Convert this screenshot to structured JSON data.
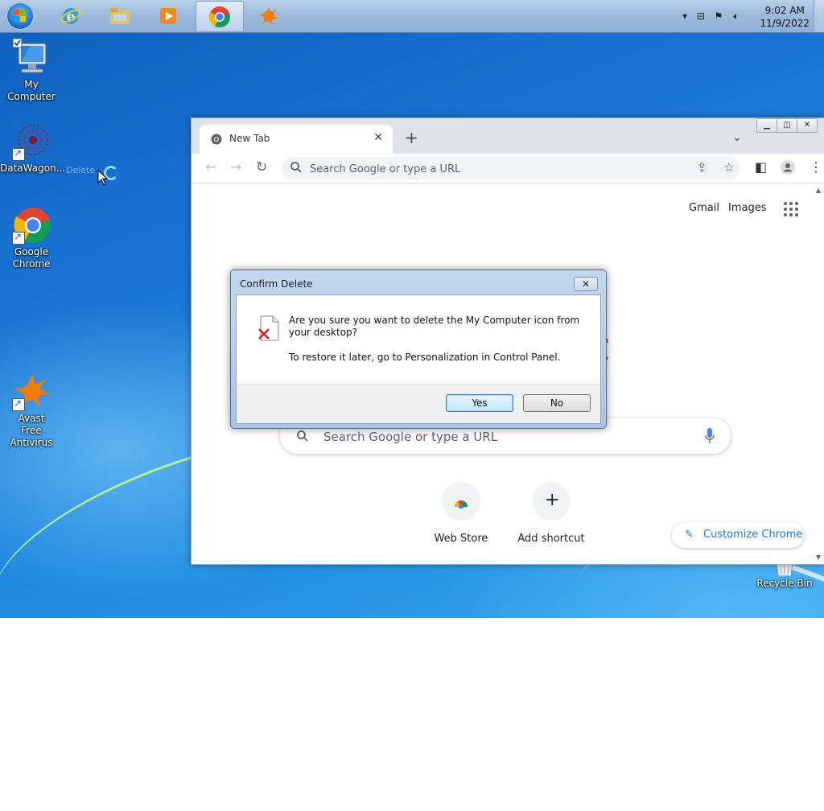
{
  "taskbar": {
    "clock_time": "9:02 AM",
    "clock_date": "11/9/2022",
    "pinned": [
      {
        "name": "internet-explorer-icon"
      },
      {
        "name": "file-explorer-icon"
      },
      {
        "name": "media-player-icon"
      },
      {
        "name": "chrome-icon",
        "active": true
      },
      {
        "name": "avast-icon"
      }
    ]
  },
  "desktop": {
    "icons": [
      {
        "label": "My Computer"
      },
      {
        "label": "DataWagon..."
      },
      {
        "label": "Google Chrome"
      },
      {
        "label": "Avast Free Antivirus"
      },
      {
        "label": "Recycle Bin"
      }
    ],
    "drag_ghost": "Delete"
  },
  "chrome": {
    "tab_title": "New Tab",
    "omnibox_placeholder": "Search Google or type a URL",
    "gmail": "Gmail",
    "images": "Images",
    "search_placeholder": "Search Google or type a URL",
    "shortcuts": [
      {
        "label": "Web Store"
      },
      {
        "label": "Add shortcut"
      }
    ],
    "customize": "Customize Chrome"
  },
  "dialog": {
    "title": "Confirm Delete",
    "message": "Are you sure you want to delete the My Computer icon from your desktop?",
    "hint": "To restore it later, go to Personalization in Control Panel.",
    "yes": "Yes",
    "no": "No",
    "close": "✕"
  },
  "colors": {
    "accent": "#1a73e8",
    "desktop_blue": "#1a74d3"
  }
}
